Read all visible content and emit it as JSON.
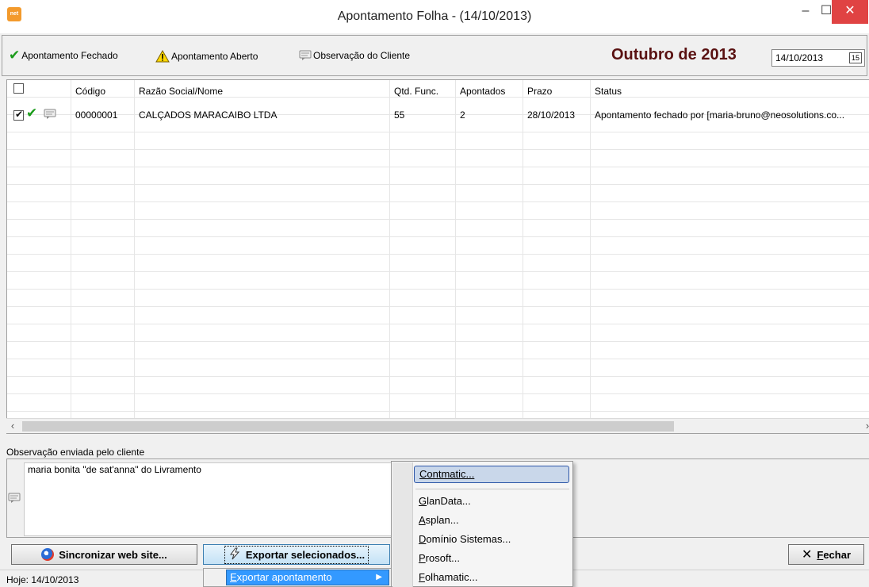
{
  "window": {
    "title": "Apontamento Folha - (14/10/2013)",
    "icon_text": "net",
    "minimize": "–",
    "maximize": "☐",
    "close": "✕"
  },
  "toolbar": {
    "legend_closed": "Apontamento Fechado",
    "legend_open": "Apontamento Aberto",
    "legend_obs": "Observação do Cliente",
    "month_title": "Outubro de 2013",
    "date_value": "14/10/2013",
    "date_button": "15"
  },
  "grid": {
    "columns": [
      "",
      "Código",
      "Razão Social/Nome",
      "Qtd. Func.",
      "Apontados",
      "Prazo",
      "Status"
    ],
    "rows": [
      {
        "checked": true,
        "codigo": "00000001",
        "razao": "CALÇADOS MARACAIBO LTDA",
        "qtd_func": "55",
        "apontados": "2",
        "prazo": "28/10/2013",
        "status": "Apontamento fechado por [maria-bruno@neosolutions.co..."
      }
    ]
  },
  "scroll": {
    "left": "‹",
    "right": "›"
  },
  "observation": {
    "label": "Observação enviada pelo cliente",
    "text": "maria bonita \"de sat'anna\" do Livramento"
  },
  "buttons": {
    "sync": "Sincronizar web site...",
    "export": "Exportar selecionados...",
    "close_accel": "F",
    "close_rest": "echar",
    "close_icon": "✕"
  },
  "status": {
    "today": "Hoje: 14/10/2013"
  },
  "menu_export": {
    "item_accel": "E",
    "item_rest": "xportar apontamento",
    "arrow": "▶"
  },
  "submenu": {
    "items": [
      {
        "accel": "C",
        "rest": "ontmatic..."
      },
      {
        "accel": "G",
        "rest": "lanData..."
      },
      {
        "accel": "A",
        "rest": "splan..."
      },
      {
        "accel": "D",
        "rest": "omínio Sistemas..."
      },
      {
        "accel": "P",
        "rest": "rosoft..."
      },
      {
        "accel": "F",
        "rest": "olhamatic..."
      }
    ]
  },
  "colors": {
    "month_title": "#5a1212",
    "check_green": "#1a9b1a",
    "close_red": "#e04343",
    "menu_highlight": "#3399ff"
  }
}
